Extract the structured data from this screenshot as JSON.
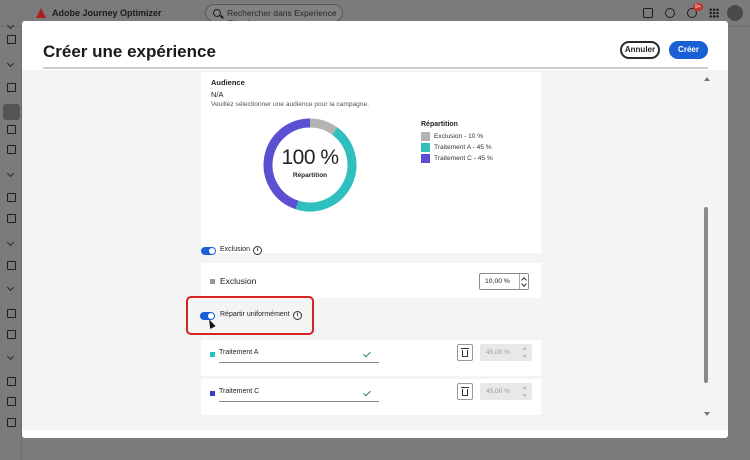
{
  "app": {
    "title": "Adobe Journey Optimizer"
  },
  "search": {
    "placeholder": "Rechercher dans Experience Cloud..."
  },
  "top_icons": [
    "help-icon",
    "chat-icon",
    "bell-icon",
    "apps-grid-icon",
    "avatar"
  ],
  "notifications": {
    "badge": "9+"
  },
  "modal": {
    "title": "Créer une expérience",
    "cancel_label": "Annuler",
    "create_label": "Créer"
  },
  "audience": {
    "label": "Audience",
    "value": "N/A",
    "hint": "Veuillez sélectionner une audience pour la campagne."
  },
  "chart_data": {
    "type": "pie",
    "donut": true,
    "center_value": "100 %",
    "center_label": "Répartition",
    "legend_title": "Répartition",
    "slices": [
      {
        "label": "Exclusion - 10 %",
        "value": 10,
        "color": "#b3b3b3"
      },
      {
        "label": "Traitement A - 45 %",
        "value": 45,
        "color": "#2fbfbf"
      },
      {
        "label": "Traitement C - 45 %",
        "value": 45,
        "color": "#5b4fd2"
      }
    ]
  },
  "exclusion_toggle": {
    "label": "Exclusion",
    "on": true
  },
  "exclusion_row": {
    "label": "Exclusion",
    "value": "10,00 %"
  },
  "distribute_toggle": {
    "label": "Répartir uniformément",
    "on": true
  },
  "treatments": [
    {
      "name": "Traitement A",
      "value": "45,00 %",
      "color": "#2fbfbf"
    },
    {
      "name": "Traitement C",
      "value": "45,00 %",
      "color": "#3c3cc8"
    }
  ],
  "colors": {
    "accent": "#1a5fd6",
    "highlight": "#d42424"
  }
}
